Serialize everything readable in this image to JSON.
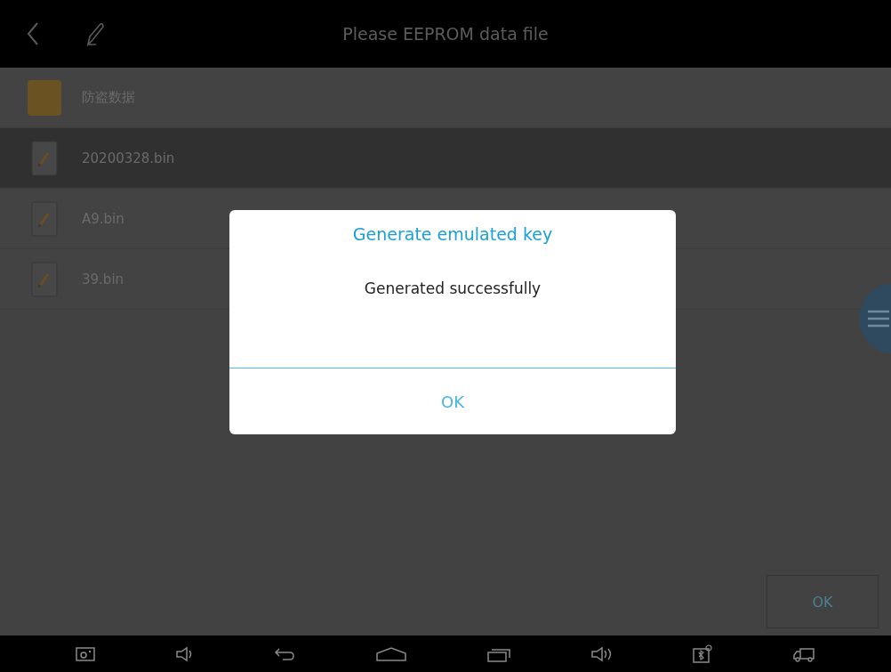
{
  "header": {
    "title": "Please EEPROM data file"
  },
  "files": [
    {
      "kind": "folder",
      "name": "防盗数据",
      "selected": false
    },
    {
      "kind": "file",
      "name": "20200328.bin",
      "selected": true
    },
    {
      "kind": "file",
      "name": "A9.bin",
      "selected": false
    },
    {
      "kind": "file",
      "name": "39.bin",
      "selected": false
    }
  ],
  "ok_button": {
    "label": "OK"
  },
  "dialog": {
    "title": "Generate emulated key",
    "message": "Generated successfully",
    "button": "OK"
  }
}
